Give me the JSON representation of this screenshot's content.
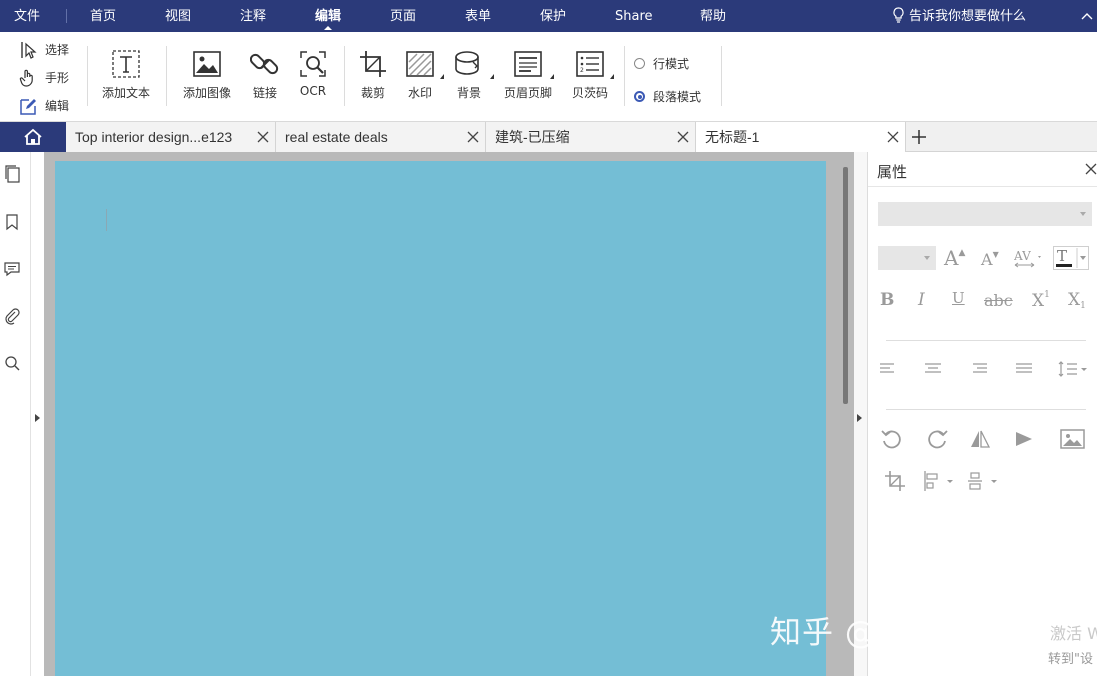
{
  "menu": {
    "items": [
      "文件",
      "首页",
      "视图",
      "注释",
      "编辑",
      "页面",
      "表单",
      "保护",
      "Share",
      "帮助"
    ],
    "active": "编辑",
    "tell_me": "告诉我你想要做什么"
  },
  "ribbon": {
    "modes": [
      "选择",
      "手形",
      "编辑"
    ],
    "tools": [
      "添加文本",
      "添加图像",
      "链接",
      "OCR",
      "裁剪",
      "水印",
      "背景",
      "页眉页脚",
      "贝茨码"
    ],
    "radio_options": [
      "行模式",
      "段落模式"
    ],
    "radio_selected": "段落模式"
  },
  "tabs": [
    "Top interior design...e123",
    "real estate deals",
    "建筑-已压缩",
    "无标题-1"
  ],
  "active_tab": "无标题-1",
  "properties": {
    "title": "属性"
  },
  "watermark": "知乎 @万兴PDF专家",
  "activation": {
    "line1": "激活 W",
    "line2": "转到\"设"
  },
  "colors": {
    "menubar": "#2b3a7a",
    "page": "#74bed5",
    "accent": "#3c5ab5"
  }
}
